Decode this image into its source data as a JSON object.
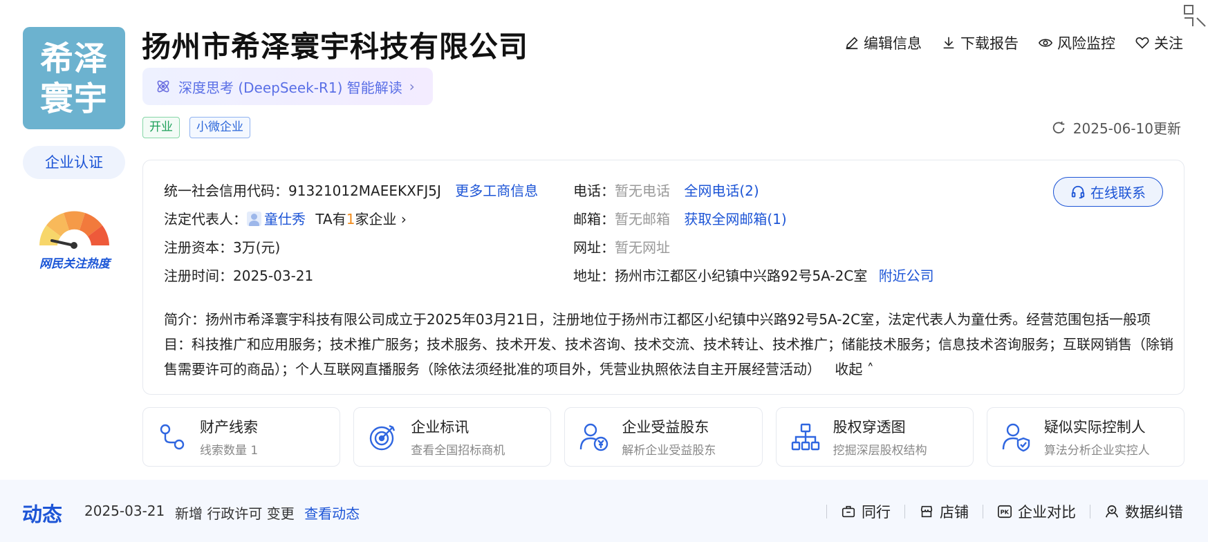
{
  "company": {
    "logo_line1": "希泽",
    "logo_line2": "寰宇",
    "name": "扬州市希泽寰宇科技有限公司",
    "ai_label": "深度思考 (DeepSeek-R1) 智能解读",
    "tags": [
      "开业",
      "小微企业"
    ],
    "certification": "企业认证",
    "heat_label": "网民关注热度",
    "update_text": "2025-06-10更新"
  },
  "actions": {
    "edit": "编辑信息",
    "download": "下载报告",
    "monitor": "风险监控",
    "follow": "关注"
  },
  "info": {
    "credit_label": "统一社会信用代码：",
    "credit_value": "91321012MAEEKXFJ5J",
    "more_biz": "更多工商信息",
    "legal_label": "法定代表人：",
    "legal_name": "童仕秀",
    "ta_prefix": "TA有",
    "ta_count": "1",
    "ta_suffix": "家企业",
    "capital_label": "注册资本：",
    "capital_value": "3万(元)",
    "reg_time_label": "注册时间：",
    "reg_time_value": "2025-03-21",
    "phone_label": "电话：",
    "phone_value": "暂无电话",
    "phone_link": "全网电话(2)",
    "email_label": "邮箱：",
    "email_value": "暂无邮箱",
    "email_link": "获取全网邮箱(1)",
    "web_label": "网址：",
    "web_value": "暂无网址",
    "addr_label": "地址：",
    "addr_value": "扬州市江都区小纪镇中兴路92号5A-2C室",
    "addr_link": "附近公司",
    "online_contact": "在线联系",
    "intro": "简介：扬州市希泽寰宇科技有限公司成立于2025年03月21日，注册地位于扬州市江都区小纪镇中兴路92号5A-2C室，法定代表人为童仕秀。经营范围包括一般项目：科技推广和应用服务；技术推广服务；技术服务、技术开发、技术咨询、技术交流、技术转让、技术推广；储能技术服务；信息技术咨询服务；互联网销售（除销售需要许可的商品）；个人互联网直播服务（除依法须经批准的项目外，凭营业执照依法自主开展经营活动）",
    "collapse": "收起"
  },
  "cards": [
    {
      "title": "财产线索",
      "sub": "线索数量 1"
    },
    {
      "title": "企业标讯",
      "sub": "查看全国招标商机"
    },
    {
      "title": "企业受益股东",
      "sub": "解析企业受益股东"
    },
    {
      "title": "股权穿透图",
      "sub": "挖掘深层股权结构"
    },
    {
      "title": "疑似实际控制人",
      "sub": "算法分析企业实控人"
    }
  ],
  "dynamics": {
    "title": "动态",
    "date": "2025-03-21",
    "text": "新增 行政许可 变更",
    "link": "查看动态"
  },
  "bottom_links": {
    "peer": "同行",
    "shop": "店铺",
    "compare": "企业对比",
    "correction": "数据纠错"
  },
  "colors": {
    "accent": "#1d55d6",
    "logo_bg": "#6cb2cf",
    "orange": "#f08a1a",
    "green": "#1ea05a"
  }
}
